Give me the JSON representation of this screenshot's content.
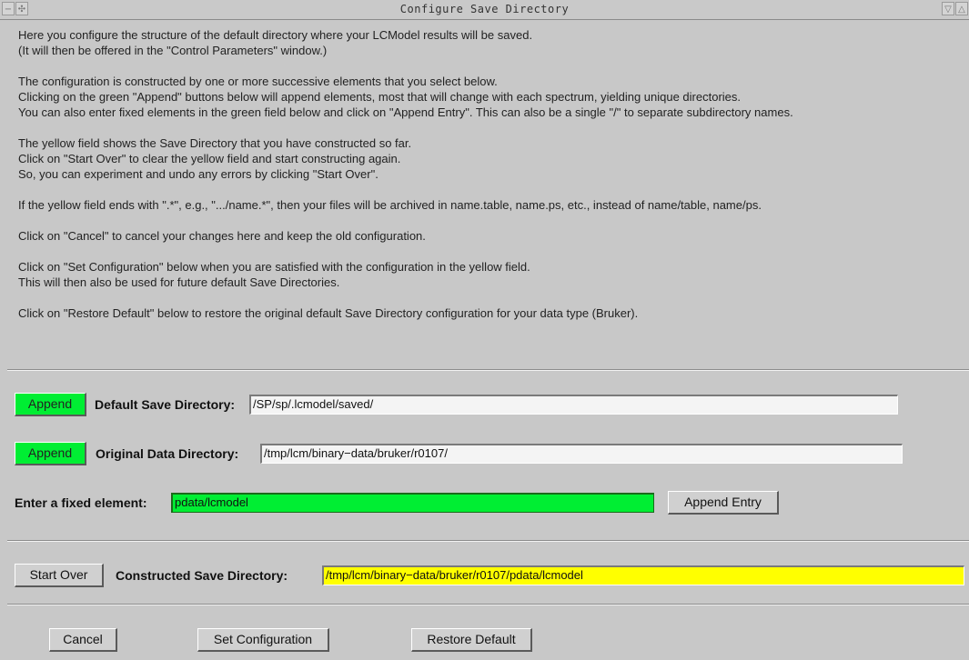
{
  "window": {
    "title": "Configure Save Directory",
    "left_controls": "−|◆",
    "right_controls": "▽|△"
  },
  "info": {
    "lines": [
      "Here you configure the structure of the default directory where your LCModel results will be saved.",
      "(It will then be offered in the \"Control Parameters\" window.)",
      "",
      "The configuration is constructed by one or more successive elements that you select below.",
      "Clicking on the green \"Append\" buttons below will append elements, most that will change with each spectrum, yielding unique directories.",
      "You can also enter fixed elements in the green field below and click on \"Append Entry\".  This can also be a single \"/\" to separate subdirectory names.",
      "",
      "The yellow field shows the Save Directory that you have constructed so far.",
      "Click on \"Start Over\" to clear the yellow field and start constructing again.",
      "So, you can experiment and undo any errors by clicking \"Start Over\".",
      "",
      "If the yellow field ends with \".*\", e.g., \".../name.*\", then your files  will be archived in name.table, name.ps, etc., instead of name/table, name/ps.",
      "",
      "Click on \"Cancel\" to cancel your changes here and keep the old configuration.",
      "",
      "Click on \"Set Configuration\" below when you are satisfied with the configuration in the yellow field.",
      "This will then also be used for future default Save Directories.",
      "",
      "Click on \"Restore Default\" below to restore the original default  Save Directory configuration for your data type (Bruker)."
    ]
  },
  "rows": {
    "default_save": {
      "button": "Append",
      "label": "Default Save Directory:",
      "value": "/SP/sp/.lcmodel/saved/"
    },
    "original_data": {
      "button": "Append",
      "label": "Original Data Directory:",
      "value": "/tmp/lcm/binary−data/bruker/r0107/"
    },
    "fixed_element": {
      "label": "Enter a fixed element:",
      "value": "pdata/lcmodel",
      "button": "Append Entry"
    },
    "constructed": {
      "button": "Start Over",
      "label": "Constructed Save Directory:",
      "value": "/tmp/lcm/binary−data/bruker/r0107/pdata/lcmodel"
    }
  },
  "footer": {
    "cancel": "Cancel",
    "set_configuration": "Set Configuration",
    "restore_default": "Restore Default"
  },
  "colors": {
    "green": "#00ee33",
    "yellow": "#ffff00",
    "background": "#c8c8c8"
  }
}
